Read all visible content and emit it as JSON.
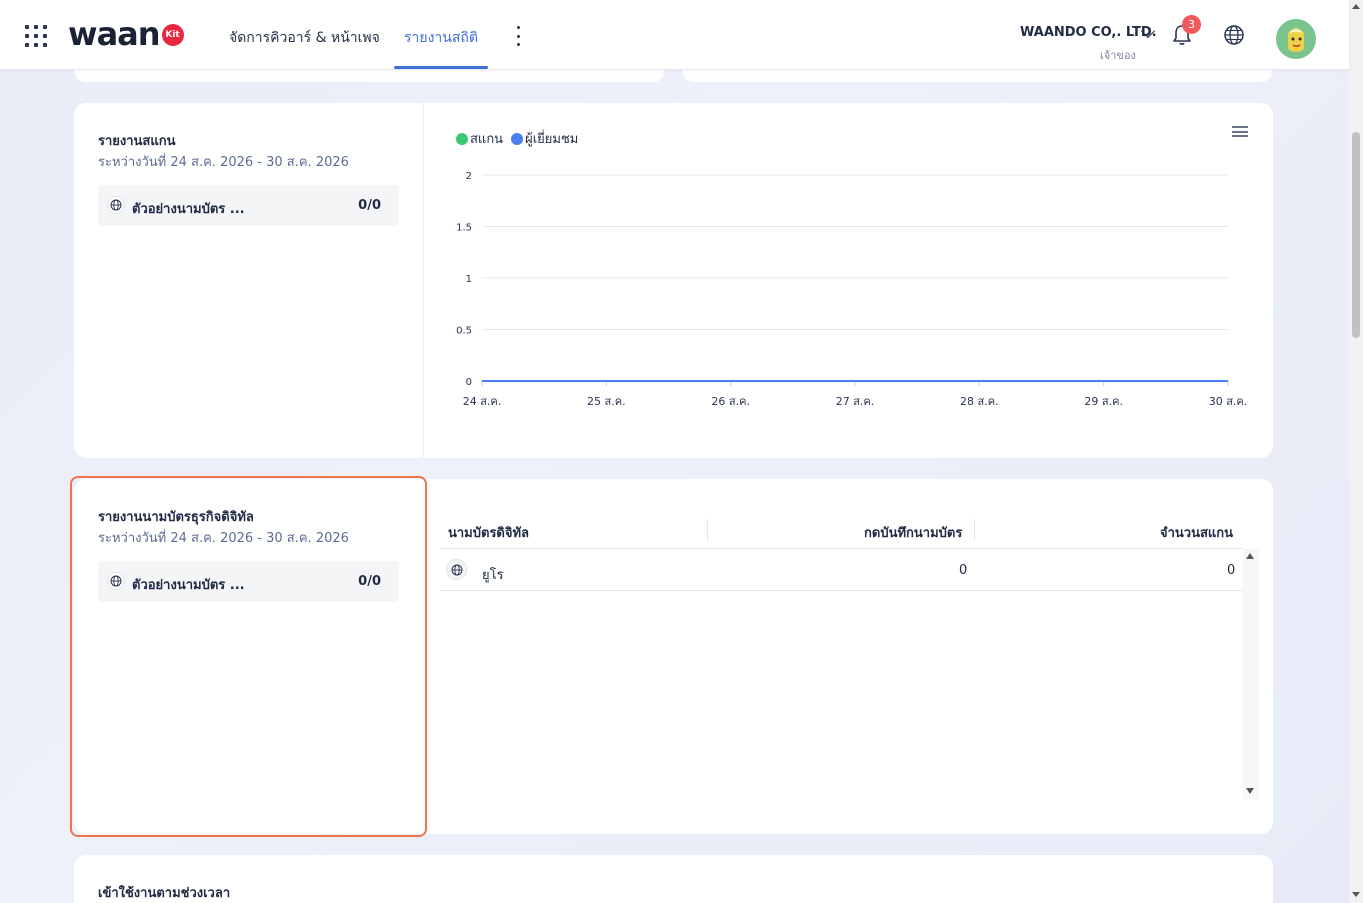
{
  "header": {
    "logo_text": "waan",
    "logo_badge": "Kit",
    "nav": [
      {
        "label": "จัดการคิวอาร์ & หน้าเพจ",
        "active": false
      },
      {
        "label": "รายงานสถิติ",
        "active": true
      }
    ],
    "company": "WAANDO CO,. LTD.",
    "role": "เจ้าของ",
    "notification_count": "3",
    "accent_color": "#3f6fd8"
  },
  "scan_report": {
    "title": "รายงานสแกน",
    "date_range": "ระหว่างวันที่ 24 ส.ค. 2026 - 30 ส.ค. 2026",
    "items": [
      {
        "name": "ตัวอย่างนามบัตร ...",
        "count": "0/0",
        "icon": "globe-icon"
      }
    ]
  },
  "chart_data": {
    "type": "line",
    "categories": [
      "24 ส.ค.",
      "25 ส.ค.",
      "26 ส.ค.",
      "27 ส.ค.",
      "28 ส.ค.",
      "29 ส.ค.",
      "30 ส.ค."
    ],
    "series": [
      {
        "name": "สแกน",
        "color": "#3cc872",
        "values": [
          0,
          0,
          0,
          0,
          0,
          0,
          0
        ]
      },
      {
        "name": "ผู้เยี่ยมชม",
        "color": "#4a7ff0",
        "values": [
          0,
          0,
          0,
          0,
          0,
          0,
          0
        ]
      }
    ],
    "y_ticks": [
      "2",
      "1.5",
      "1",
      "0.5",
      "0"
    ],
    "ylim": [
      0,
      2
    ],
    "grid": true,
    "legend": "top-left"
  },
  "card_report": {
    "title": "รายงานนามบัตรธุรกิจดิจิทัล",
    "date_range": "ระหว่างวันที่ 24 ส.ค. 2026 - 30 ส.ค. 2026",
    "items": [
      {
        "name": "ตัวอย่างนามบัตร ...",
        "count": "0/0",
        "icon": "globe-icon"
      }
    ],
    "highlight_color": "#ef7450"
  },
  "card_table": {
    "columns": [
      "นามบัตรดิจิทัล",
      "กดบันทึกนามบัตร",
      "จำนวนสแกน"
    ],
    "rows": [
      {
        "name": "ยูโร",
        "saves": "0",
        "scans": "0",
        "icon": "globe-icon"
      }
    ]
  },
  "time_usage": {
    "title": "เข้าใช้งานตามช่วงเวลา"
  }
}
